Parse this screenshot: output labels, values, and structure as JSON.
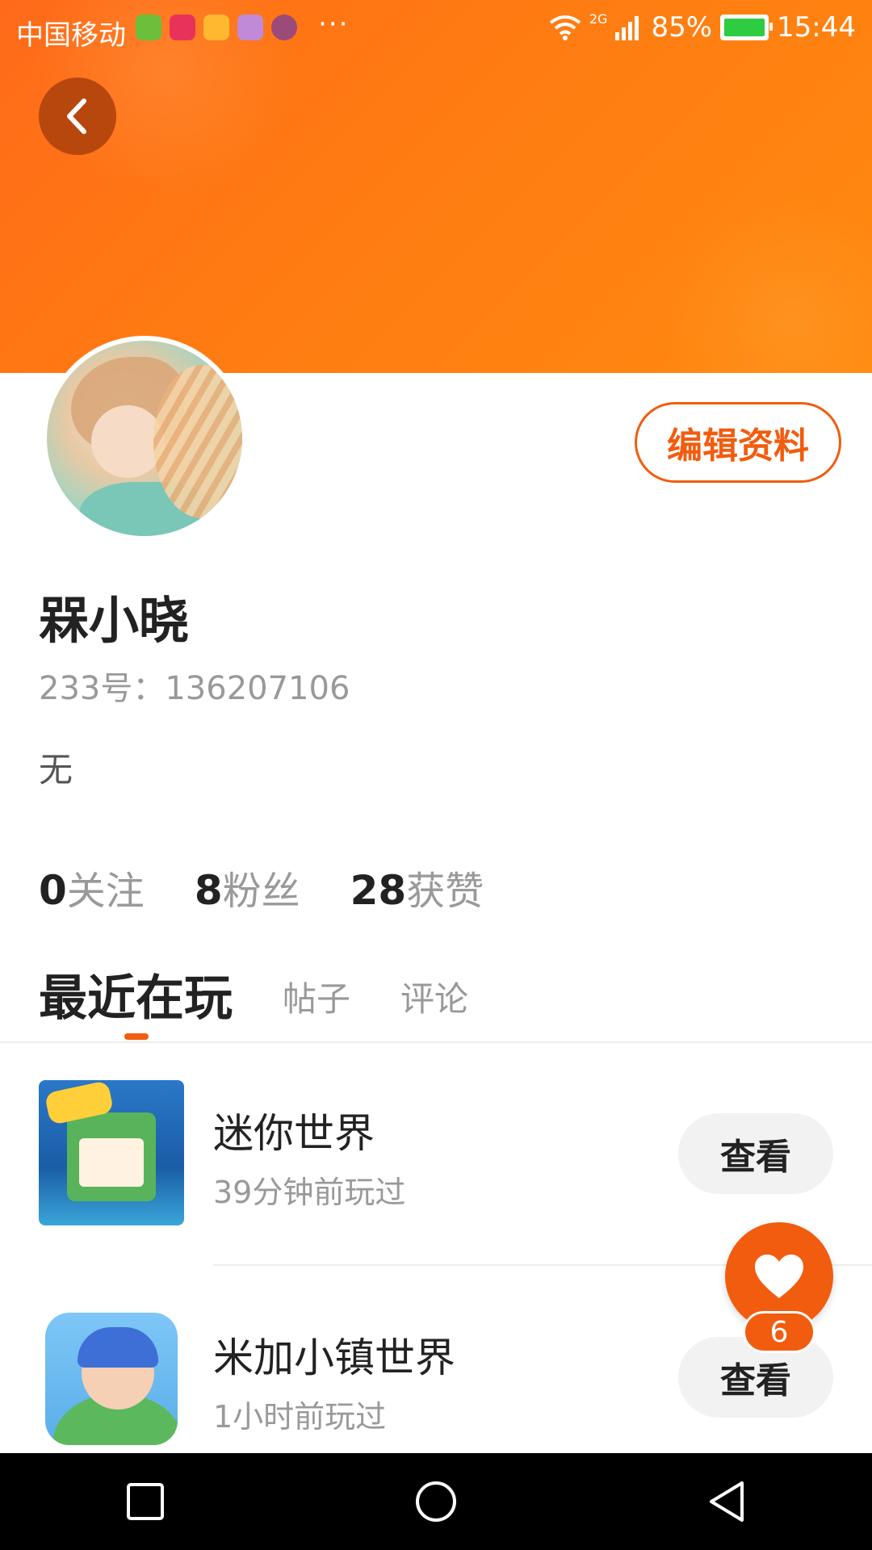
{
  "status_bar": {
    "carrier": "中国移动",
    "more": "···",
    "network": "2G",
    "battery_percent": "85%",
    "time": "15:44"
  },
  "profile": {
    "nickname": "槑小晓",
    "user_id": "233号：136207106",
    "bio": "无",
    "edit_button": "编辑资料"
  },
  "stats": {
    "following_count": "0",
    "following_label": "关注",
    "fans_count": "8",
    "fans_label": "粉丝",
    "likes_count": "28",
    "likes_label": "获赞"
  },
  "tabs": [
    {
      "label": "最近在玩",
      "active": true
    },
    {
      "label": "帖子",
      "active": false
    },
    {
      "label": "评论",
      "active": false
    }
  ],
  "games": [
    {
      "title": "迷你世界",
      "played": "39分钟前玩过",
      "button": "查看"
    },
    {
      "title": "米加小镇世界",
      "played": "1小时前玩过",
      "button": "查看"
    }
  ],
  "fab": {
    "count": "6"
  },
  "colors": {
    "accent": "#f25c0f",
    "header": "#ff7a12"
  }
}
